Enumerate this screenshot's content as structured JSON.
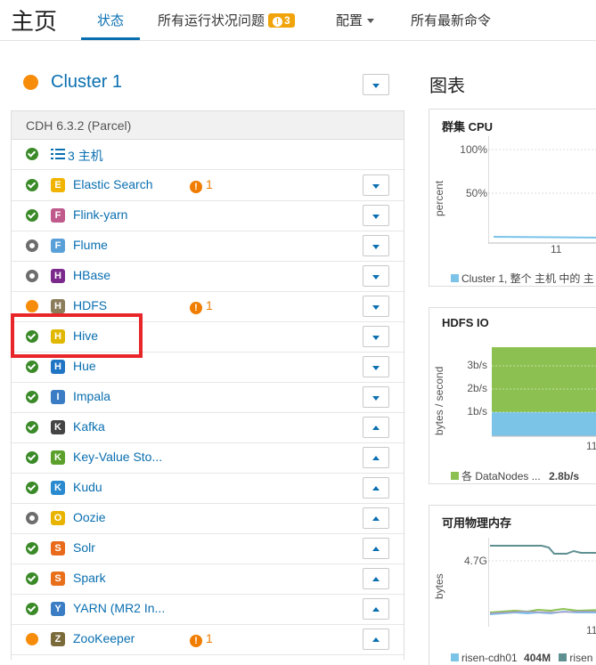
{
  "header": {
    "title": "主页",
    "tabs": [
      {
        "label": "状态",
        "active": true
      },
      {
        "label": "所有运行状况问题",
        "badge": "3"
      },
      {
        "label": "配置",
        "has_caret": true
      },
      {
        "label": "所有最新命令"
      }
    ]
  },
  "cluster": {
    "name": "Cluster 1",
    "status_color": "#f78c0b"
  },
  "services_panel": {
    "version": "CDH 6.3.2 (Parcel)",
    "hosts_label": "3 主机",
    "services": [
      {
        "name": "Elastic Search",
        "status": "good",
        "icon": "elastic-search-icon",
        "alerts": "1",
        "menu": "down"
      },
      {
        "name": "Flink-yarn",
        "status": "good",
        "icon": "flink-icon",
        "menu": "down"
      },
      {
        "name": "Flume",
        "status": "stopped",
        "icon": "flume-icon",
        "menu": "down"
      },
      {
        "name": "HBase",
        "status": "stopped",
        "icon": "hbase-icon",
        "menu": "down"
      },
      {
        "name": "HDFS",
        "status": "warn",
        "icon": "hdfs-icon",
        "alerts": "1",
        "menu": "down"
      },
      {
        "name": "Hive",
        "status": "good",
        "icon": "hive-icon",
        "menu": "down"
      },
      {
        "name": "Hue",
        "status": "good",
        "icon": "hue-icon",
        "menu": "down"
      },
      {
        "name": "Impala",
        "status": "good",
        "icon": "impala-icon",
        "menu": "down"
      },
      {
        "name": "Kafka",
        "status": "good",
        "icon": "kafka-icon",
        "menu": "up"
      },
      {
        "name": "Key-Value Sto...",
        "status": "good",
        "icon": "key-value-store-icon",
        "menu": "up"
      },
      {
        "name": "Kudu",
        "status": "good",
        "icon": "kudu-icon",
        "menu": "up"
      },
      {
        "name": "Oozie",
        "status": "stopped",
        "icon": "oozie-icon",
        "menu": "up"
      },
      {
        "name": "Solr",
        "status": "good",
        "icon": "solr-icon",
        "menu": "up"
      },
      {
        "name": "Spark",
        "status": "good",
        "icon": "spark-icon",
        "menu": "up"
      },
      {
        "name": "YARN (MR2 In...",
        "status": "good",
        "icon": "yarn-icon",
        "menu": "up"
      },
      {
        "name": "ZooKeeper",
        "status": "warn",
        "icon": "zookeeper-icon",
        "alerts": "1",
        "menu": "up"
      }
    ]
  },
  "charts": {
    "heading": "图表",
    "cluster_cpu": {
      "title": "群集 CPU",
      "ylabel": "percent",
      "ticks": [
        "100%",
        "50%"
      ],
      "xtick": "11",
      "legend": "Cluster 1, 整个 主机 中的 主"
    },
    "hdfs_io": {
      "title": "HDFS IO",
      "ylabel": "bytes / second",
      "ticks": [
        "3b/s",
        "2b/s",
        "1b/s"
      ],
      "xtick": "11",
      "legend": "各 DataNodes ...",
      "legend_value": "2.8b/s"
    },
    "memory": {
      "title": "可用物理内存",
      "ylabel": "bytes",
      "ticks": [
        "4.7G"
      ],
      "xtick": "11",
      "legend": "risen-cdh01",
      "legend_value": "404M",
      "legend2": "risen"
    }
  },
  "colors": {
    "accent": "#0a6fb0",
    "good": "#3a8a28",
    "warn": "#f78c0b",
    "stopped": "#6d6d6d",
    "chart_green": "#8cc152",
    "chart_blue": "#7cc3e8"
  }
}
